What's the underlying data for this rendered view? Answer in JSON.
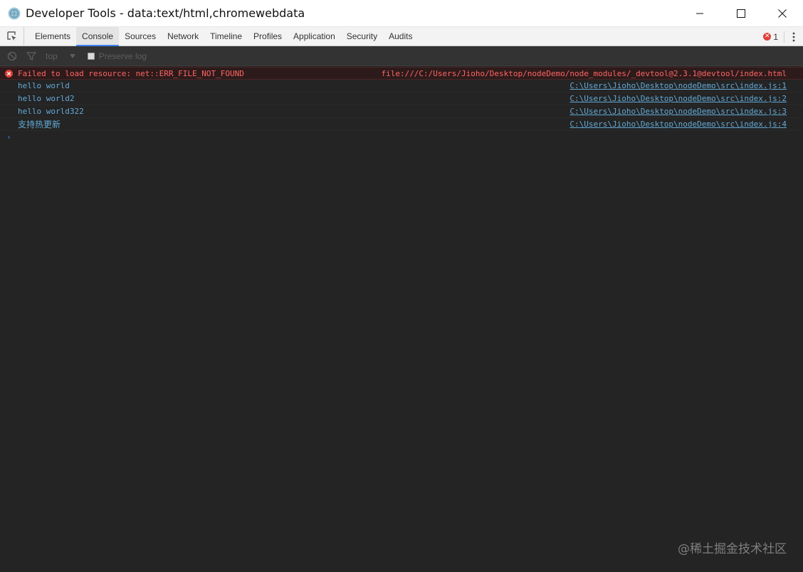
{
  "window": {
    "title": "Developer Tools - data:text/html,chromewebdata"
  },
  "tabs": [
    {
      "label": "Elements",
      "active": false
    },
    {
      "label": "Console",
      "active": true
    },
    {
      "label": "Sources",
      "active": false
    },
    {
      "label": "Network",
      "active": false
    },
    {
      "label": "Timeline",
      "active": false
    },
    {
      "label": "Profiles",
      "active": false
    },
    {
      "label": "Application",
      "active": false
    },
    {
      "label": "Security",
      "active": false
    },
    {
      "label": "Audits",
      "active": false
    }
  ],
  "error_badge": {
    "count": "1",
    "icon": "error-icon"
  },
  "toolbar": {
    "context": "top",
    "preserve_log_label": "Preserve log",
    "preserve_log_checked": false
  },
  "messages": [
    {
      "type": "error",
      "text": "Failed to load resource: net::ERR_FILE_NOT_FOUND",
      "source": "file:///C:/Users/Jioho/Desktop/nodeDemo/node_modules/_devtool@2.3.1@devtool/index.html"
    },
    {
      "type": "log",
      "text": "hello world",
      "source": "C:\\Users\\Jioho\\Desktop\\nodeDemo\\src\\index.js:1"
    },
    {
      "type": "log",
      "text": "hello world2",
      "source": "C:\\Users\\Jioho\\Desktop\\nodeDemo\\src\\index.js:2"
    },
    {
      "type": "log",
      "text": "hello world322",
      "source": "C:\\Users\\Jioho\\Desktop\\nodeDemo\\src\\index.js:3"
    },
    {
      "type": "log",
      "text": "支持热更新",
      "source": "C:\\Users\\Jioho\\Desktop\\nodeDemo\\src\\index.js:4"
    }
  ],
  "prompt_symbol": "›",
  "watermark": "@稀土掘金技术社区",
  "colors": {
    "error": "#ff6464",
    "log": "#63a9d6",
    "accent": "#3e82f7",
    "background": "#242424"
  }
}
